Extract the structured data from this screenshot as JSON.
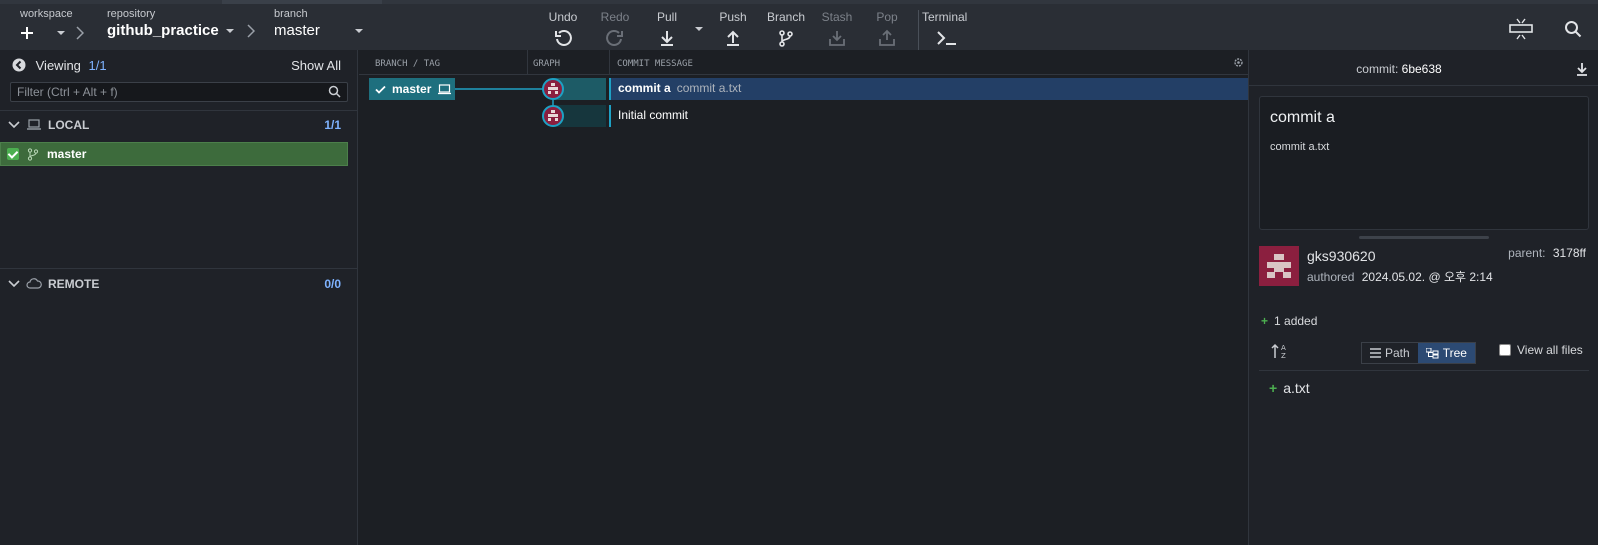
{
  "toolbar": {
    "workspace_label": "workspace",
    "repository_label": "repository",
    "repository_name": "github_practice",
    "branch_label": "branch",
    "branch_name": "master",
    "tools": {
      "undo": "Undo",
      "redo": "Redo",
      "pull": "Pull",
      "push": "Push",
      "branch": "Branch",
      "stash": "Stash",
      "pop": "Pop",
      "terminal": "Terminal"
    }
  },
  "sidebar": {
    "viewing_label": "Viewing",
    "viewing_count": "1/1",
    "show_all": "Show All",
    "filter_placeholder": "Filter (Ctrl + Alt + f)",
    "local": {
      "label": "LOCAL",
      "count": "1/1",
      "branches": [
        "master"
      ]
    },
    "remote": {
      "label": "REMOTE",
      "count": "0/0"
    }
  },
  "graph": {
    "headers": {
      "branch_tag": "BRANCH / TAG",
      "graph": "GRAPH",
      "commit_message": "COMMIT MESSAGE"
    },
    "head_tag": "master",
    "commits": [
      {
        "summary": "commit a",
        "description": "commit a.txt"
      },
      {
        "summary": "Initial commit",
        "description": ""
      }
    ]
  },
  "details": {
    "commit_label": "commit:",
    "commit_sha": "6be638",
    "title": "commit a",
    "body": "commit a.txt",
    "author": "gks930620",
    "authored_label": "authored",
    "authored_date": "2024.05.02. @ 오후 2:14",
    "parent_label": "parent:",
    "parent_sha": "3178ff",
    "changes_summary": "1 added",
    "path_label": "Path",
    "tree_label": "Tree",
    "view_all_files": "View all files",
    "files": [
      "a.txt"
    ]
  },
  "colors": {
    "accent_tag": "#1e6f7e",
    "selected_row": "#233f66",
    "local_branch": "#3d6b3c",
    "added_green": "#4caf50",
    "avatar": "#8b1f3f"
  }
}
